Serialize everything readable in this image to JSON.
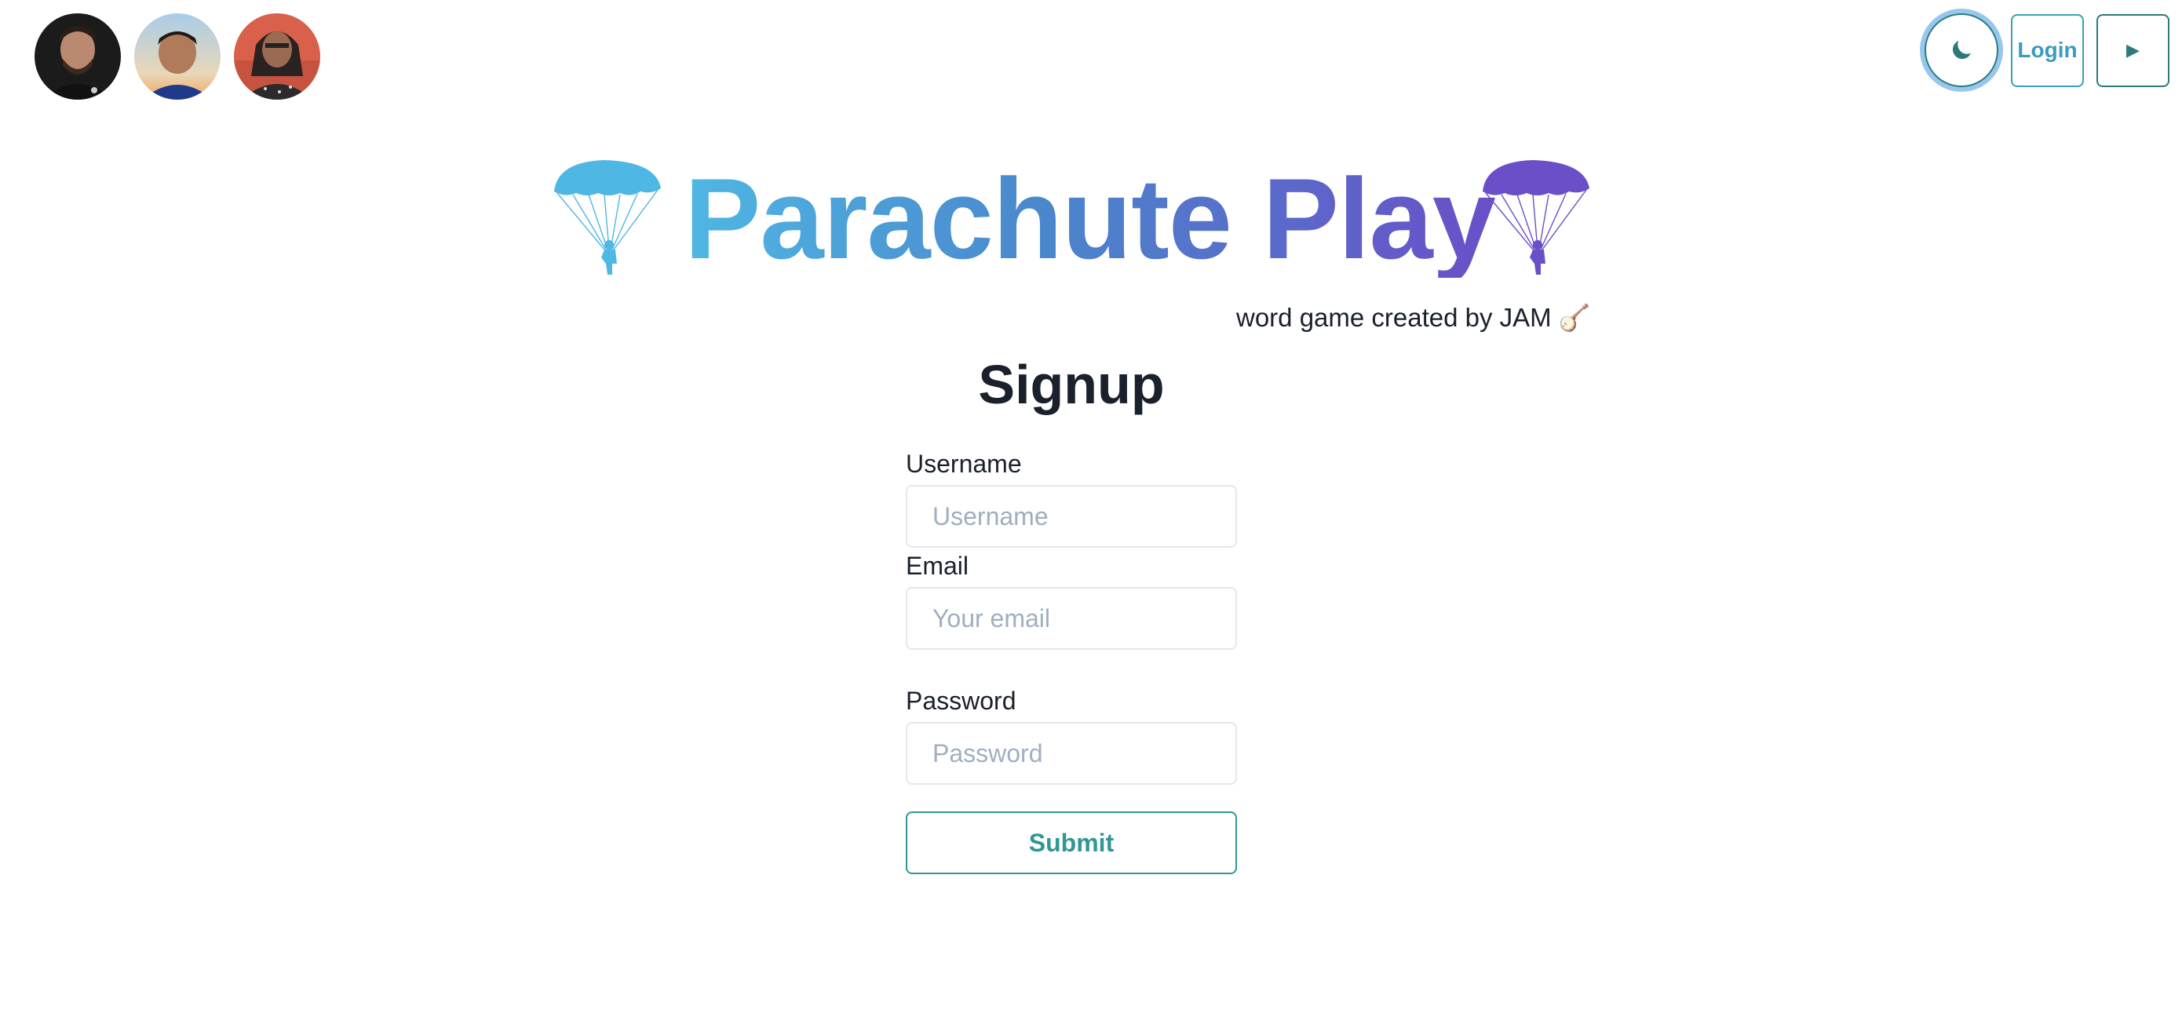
{
  "avatars": [
    {
      "name": "avatar-1",
      "bg": "#1b1b1b"
    },
    {
      "name": "avatar-2",
      "bg": "#a9cde8"
    },
    {
      "name": "avatar-3",
      "bg": "#d9604a"
    }
  ],
  "toolbar": {
    "theme_icon": "moon-icon",
    "login_label": "Login",
    "play_icon": "play-icon",
    "play_glyph": "▶"
  },
  "header": {
    "title": "Parachute Play",
    "subtitle": "word game created by JAM 🪕",
    "left_icon": "parachute-icon",
    "right_icon": "parachute-icon",
    "left_color": "#4fb7e3",
    "right_color": "#6a4fc8"
  },
  "form": {
    "heading": "Signup",
    "username_label": "Username",
    "username_placeholder": "Username",
    "email_label": "Email",
    "email_placeholder": "Your email",
    "password_label": "Password",
    "password_placeholder": "Password",
    "submit_label": "Submit"
  },
  "colors": {
    "accent_teal": "#319795",
    "link_blue": "#3a9cbf",
    "focus_ring": "#4299e1"
  }
}
